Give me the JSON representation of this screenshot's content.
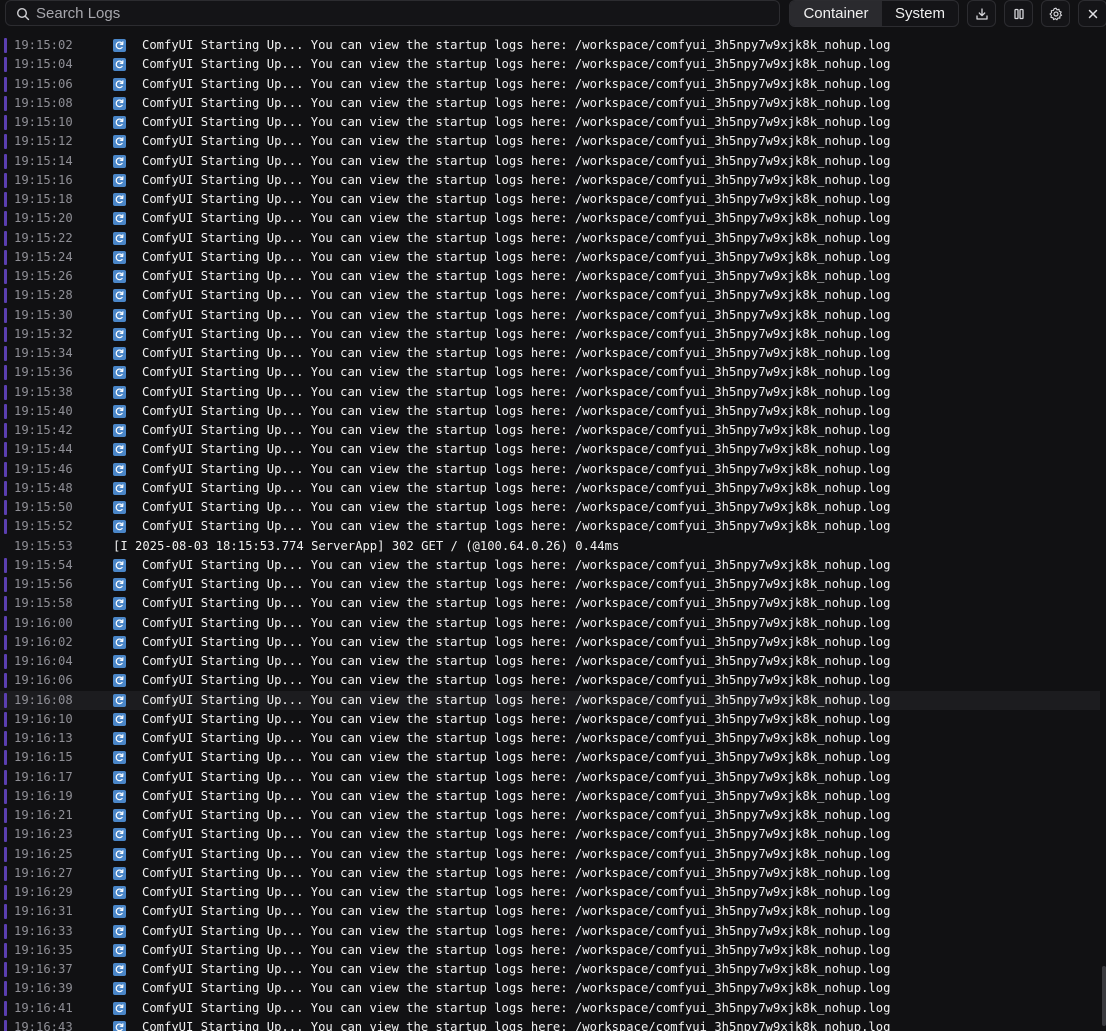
{
  "toolbar": {
    "search_placeholder": "Search Logs",
    "tabs": [
      {
        "label": "Container",
        "active": true
      },
      {
        "label": "System",
        "active": false
      }
    ],
    "icons": [
      "download-icon",
      "columns-icon",
      "gear-icon",
      "close-icon"
    ]
  },
  "colors": {
    "background": "#111113",
    "accent_bar": "#5b3fb0",
    "timestamp": "#8f8f96",
    "message": "#f2f2f2",
    "icon_blue": "#4a86c8"
  },
  "logs": {
    "startup_message": "ComfyUI Starting Up... You can view the startup logs here: /workspace/comfyui_3h5npy7w9xjk8k_nohup.log",
    "rows": [
      {
        "time": "19:15:02",
        "icon": "refresh-icon",
        "msg": "ComfyUI Starting Up... You can view the startup logs here: /workspace/comfyui_3h5npy7w9xjk8k_nohup.log",
        "bar": true
      },
      {
        "time": "19:15:04",
        "icon": "refresh-icon",
        "msg": "ComfyUI Starting Up... You can view the startup logs here: /workspace/comfyui_3h5npy7w9xjk8k_nohup.log",
        "bar": true
      },
      {
        "time": "19:15:06",
        "icon": "refresh-icon",
        "msg": "ComfyUI Starting Up... You can view the startup logs here: /workspace/comfyui_3h5npy7w9xjk8k_nohup.log",
        "bar": true
      },
      {
        "time": "19:15:08",
        "icon": "refresh-icon",
        "msg": "ComfyUI Starting Up... You can view the startup logs here: /workspace/comfyui_3h5npy7w9xjk8k_nohup.log",
        "bar": true
      },
      {
        "time": "19:15:10",
        "icon": "refresh-icon",
        "msg": "ComfyUI Starting Up... You can view the startup logs here: /workspace/comfyui_3h5npy7w9xjk8k_nohup.log",
        "bar": true
      },
      {
        "time": "19:15:12",
        "icon": "refresh-icon",
        "msg": "ComfyUI Starting Up... You can view the startup logs here: /workspace/comfyui_3h5npy7w9xjk8k_nohup.log",
        "bar": true
      },
      {
        "time": "19:15:14",
        "icon": "refresh-icon",
        "msg": "ComfyUI Starting Up... You can view the startup logs here: /workspace/comfyui_3h5npy7w9xjk8k_nohup.log",
        "bar": true
      },
      {
        "time": "19:15:16",
        "icon": "refresh-icon",
        "msg": "ComfyUI Starting Up... You can view the startup logs here: /workspace/comfyui_3h5npy7w9xjk8k_nohup.log",
        "bar": true
      },
      {
        "time": "19:15:18",
        "icon": "refresh-icon",
        "msg": "ComfyUI Starting Up... You can view the startup logs here: /workspace/comfyui_3h5npy7w9xjk8k_nohup.log",
        "bar": true
      },
      {
        "time": "19:15:20",
        "icon": "refresh-icon",
        "msg": "ComfyUI Starting Up... You can view the startup logs here: /workspace/comfyui_3h5npy7w9xjk8k_nohup.log",
        "bar": true
      },
      {
        "time": "19:15:22",
        "icon": "refresh-icon",
        "msg": "ComfyUI Starting Up... You can view the startup logs here: /workspace/comfyui_3h5npy7w9xjk8k_nohup.log",
        "bar": true
      },
      {
        "time": "19:15:24",
        "icon": "refresh-icon",
        "msg": "ComfyUI Starting Up... You can view the startup logs here: /workspace/comfyui_3h5npy7w9xjk8k_nohup.log",
        "bar": true
      },
      {
        "time": "19:15:26",
        "icon": "refresh-icon",
        "msg": "ComfyUI Starting Up... You can view the startup logs here: /workspace/comfyui_3h5npy7w9xjk8k_nohup.log",
        "bar": true
      },
      {
        "time": "19:15:28",
        "icon": "refresh-icon",
        "msg": "ComfyUI Starting Up... You can view the startup logs here: /workspace/comfyui_3h5npy7w9xjk8k_nohup.log",
        "bar": true
      },
      {
        "time": "19:15:30",
        "icon": "refresh-icon",
        "msg": "ComfyUI Starting Up... You can view the startup logs here: /workspace/comfyui_3h5npy7w9xjk8k_nohup.log",
        "bar": true
      },
      {
        "time": "19:15:32",
        "icon": "refresh-icon",
        "msg": "ComfyUI Starting Up... You can view the startup logs here: /workspace/comfyui_3h5npy7w9xjk8k_nohup.log",
        "bar": true
      },
      {
        "time": "19:15:34",
        "icon": "refresh-icon",
        "msg": "ComfyUI Starting Up... You can view the startup logs here: /workspace/comfyui_3h5npy7w9xjk8k_nohup.log",
        "bar": true
      },
      {
        "time": "19:15:36",
        "icon": "refresh-icon",
        "msg": "ComfyUI Starting Up... You can view the startup logs here: /workspace/comfyui_3h5npy7w9xjk8k_nohup.log",
        "bar": true
      },
      {
        "time": "19:15:38",
        "icon": "refresh-icon",
        "msg": "ComfyUI Starting Up... You can view the startup logs here: /workspace/comfyui_3h5npy7w9xjk8k_nohup.log",
        "bar": true
      },
      {
        "time": "19:15:40",
        "icon": "refresh-icon",
        "msg": "ComfyUI Starting Up... You can view the startup logs here: /workspace/comfyui_3h5npy7w9xjk8k_nohup.log",
        "bar": true
      },
      {
        "time": "19:15:42",
        "icon": "refresh-icon",
        "msg": "ComfyUI Starting Up... You can view the startup logs here: /workspace/comfyui_3h5npy7w9xjk8k_nohup.log",
        "bar": true
      },
      {
        "time": "19:15:44",
        "icon": "refresh-icon",
        "msg": "ComfyUI Starting Up... You can view the startup logs here: /workspace/comfyui_3h5npy7w9xjk8k_nohup.log",
        "bar": true
      },
      {
        "time": "19:15:46",
        "icon": "refresh-icon",
        "msg": "ComfyUI Starting Up... You can view the startup logs here: /workspace/comfyui_3h5npy7w9xjk8k_nohup.log",
        "bar": true
      },
      {
        "time": "19:15:48",
        "icon": "refresh-icon",
        "msg": "ComfyUI Starting Up... You can view the startup logs here: /workspace/comfyui_3h5npy7w9xjk8k_nohup.log",
        "bar": true
      },
      {
        "time": "19:15:50",
        "icon": "refresh-icon",
        "msg": "ComfyUI Starting Up... You can view the startup logs here: /workspace/comfyui_3h5npy7w9xjk8k_nohup.log",
        "bar": true
      },
      {
        "time": "19:15:52",
        "icon": "refresh-icon",
        "msg": "ComfyUI Starting Up... You can view the startup logs here: /workspace/comfyui_3h5npy7w9xjk8k_nohup.log",
        "bar": true
      },
      {
        "time": "19:15:53",
        "icon": "",
        "msg": "[I 2025-08-03 18:15:53.774 ServerApp] 302 GET / (@100.64.0.26) 0.44ms",
        "bar": false
      },
      {
        "time": "19:15:54",
        "icon": "refresh-icon",
        "msg": "ComfyUI Starting Up... You can view the startup logs here: /workspace/comfyui_3h5npy7w9xjk8k_nohup.log",
        "bar": true
      },
      {
        "time": "19:15:56",
        "icon": "refresh-icon",
        "msg": "ComfyUI Starting Up... You can view the startup logs here: /workspace/comfyui_3h5npy7w9xjk8k_nohup.log",
        "bar": true
      },
      {
        "time": "19:15:58",
        "icon": "refresh-icon",
        "msg": "ComfyUI Starting Up... You can view the startup logs here: /workspace/comfyui_3h5npy7w9xjk8k_nohup.log",
        "bar": true
      },
      {
        "time": "19:16:00",
        "icon": "refresh-icon",
        "msg": "ComfyUI Starting Up... You can view the startup logs here: /workspace/comfyui_3h5npy7w9xjk8k_nohup.log",
        "bar": true
      },
      {
        "time": "19:16:02",
        "icon": "refresh-icon",
        "msg": "ComfyUI Starting Up... You can view the startup logs here: /workspace/comfyui_3h5npy7w9xjk8k_nohup.log",
        "bar": true
      },
      {
        "time": "19:16:04",
        "icon": "refresh-icon",
        "msg": "ComfyUI Starting Up... You can view the startup logs here: /workspace/comfyui_3h5npy7w9xjk8k_nohup.log",
        "bar": true
      },
      {
        "time": "19:16:06",
        "icon": "refresh-icon",
        "msg": "ComfyUI Starting Up... You can view the startup logs here: /workspace/comfyui_3h5npy7w9xjk8k_nohup.log",
        "bar": true
      },
      {
        "time": "19:16:08",
        "icon": "refresh-icon",
        "msg": "ComfyUI Starting Up... You can view the startup logs here: /workspace/comfyui_3h5npy7w9xjk8k_nohup.log",
        "bar": true,
        "highlight": true
      },
      {
        "time": "19:16:10",
        "icon": "refresh-icon",
        "msg": "ComfyUI Starting Up... You can view the startup logs here: /workspace/comfyui_3h5npy7w9xjk8k_nohup.log",
        "bar": true
      },
      {
        "time": "19:16:13",
        "icon": "refresh-icon",
        "msg": "ComfyUI Starting Up... You can view the startup logs here: /workspace/comfyui_3h5npy7w9xjk8k_nohup.log",
        "bar": true
      },
      {
        "time": "19:16:15",
        "icon": "refresh-icon",
        "msg": "ComfyUI Starting Up... You can view the startup logs here: /workspace/comfyui_3h5npy7w9xjk8k_nohup.log",
        "bar": true
      },
      {
        "time": "19:16:17",
        "icon": "refresh-icon",
        "msg": "ComfyUI Starting Up... You can view the startup logs here: /workspace/comfyui_3h5npy7w9xjk8k_nohup.log",
        "bar": true
      },
      {
        "time": "19:16:19",
        "icon": "refresh-icon",
        "msg": "ComfyUI Starting Up... You can view the startup logs here: /workspace/comfyui_3h5npy7w9xjk8k_nohup.log",
        "bar": true
      },
      {
        "time": "19:16:21",
        "icon": "refresh-icon",
        "msg": "ComfyUI Starting Up... You can view the startup logs here: /workspace/comfyui_3h5npy7w9xjk8k_nohup.log",
        "bar": true
      },
      {
        "time": "19:16:23",
        "icon": "refresh-icon",
        "msg": "ComfyUI Starting Up... You can view the startup logs here: /workspace/comfyui_3h5npy7w9xjk8k_nohup.log",
        "bar": true
      },
      {
        "time": "19:16:25",
        "icon": "refresh-icon",
        "msg": "ComfyUI Starting Up... You can view the startup logs here: /workspace/comfyui_3h5npy7w9xjk8k_nohup.log",
        "bar": true
      },
      {
        "time": "19:16:27",
        "icon": "refresh-icon",
        "msg": "ComfyUI Starting Up... You can view the startup logs here: /workspace/comfyui_3h5npy7w9xjk8k_nohup.log",
        "bar": true
      },
      {
        "time": "19:16:29",
        "icon": "refresh-icon",
        "msg": "ComfyUI Starting Up... You can view the startup logs here: /workspace/comfyui_3h5npy7w9xjk8k_nohup.log",
        "bar": true
      },
      {
        "time": "19:16:31",
        "icon": "refresh-icon",
        "msg": "ComfyUI Starting Up... You can view the startup logs here: /workspace/comfyui_3h5npy7w9xjk8k_nohup.log",
        "bar": true
      },
      {
        "time": "19:16:33",
        "icon": "refresh-icon",
        "msg": "ComfyUI Starting Up... You can view the startup logs here: /workspace/comfyui_3h5npy7w9xjk8k_nohup.log",
        "bar": true
      },
      {
        "time": "19:16:35",
        "icon": "refresh-icon",
        "msg": "ComfyUI Starting Up... You can view the startup logs here: /workspace/comfyui_3h5npy7w9xjk8k_nohup.log",
        "bar": true
      },
      {
        "time": "19:16:37",
        "icon": "refresh-icon",
        "msg": "ComfyUI Starting Up... You can view the startup logs here: /workspace/comfyui_3h5npy7w9xjk8k_nohup.log",
        "bar": true
      },
      {
        "time": "19:16:39",
        "icon": "refresh-icon",
        "msg": "ComfyUI Starting Up... You can view the startup logs here: /workspace/comfyui_3h5npy7w9xjk8k_nohup.log",
        "bar": true
      },
      {
        "time": "19:16:41",
        "icon": "refresh-icon",
        "msg": "ComfyUI Starting Up... You can view the startup logs here: /workspace/comfyui_3h5npy7w9xjk8k_nohup.log",
        "bar": true
      },
      {
        "time": "19:16:43",
        "icon": "refresh-icon",
        "msg": "ComfyUI Starting Up... You can view the startup logs here: /workspace/comfyui_3h5npy7w9xjk8k_nohup.log",
        "bar": true
      }
    ]
  }
}
